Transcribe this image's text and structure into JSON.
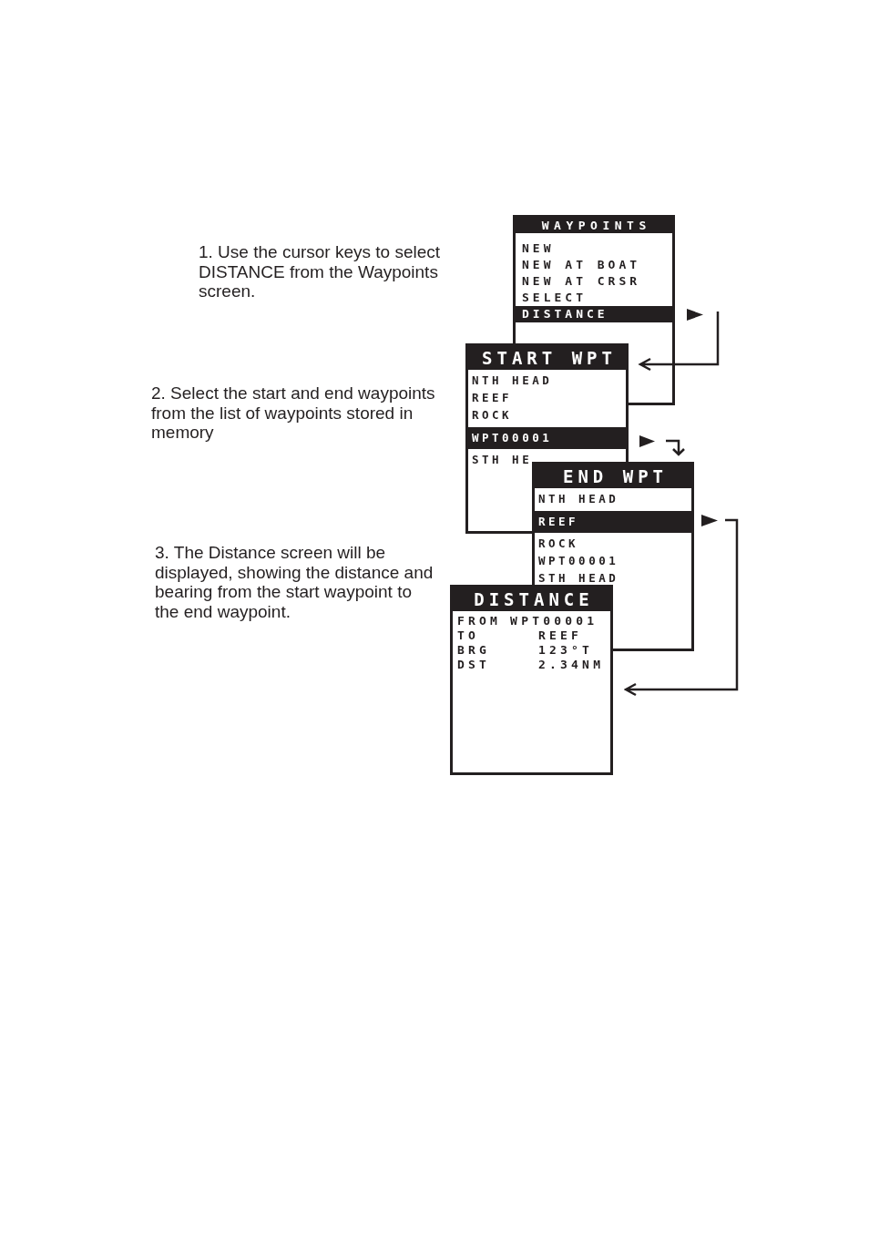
{
  "steps": [
    "1. Use the cursor keys to select DISTANCE from the Waypoints screen.",
    "2. Select the start and end waypoints from the list of waypoints stored in memory",
    "3. The Distance screen will be displayed, showing the distance and bearing from the start waypoint to the end waypoint."
  ],
  "screens": [
    {
      "kind": "menu",
      "title": "WAYPOINTS",
      "items": [
        {
          "label": "NEW",
          "selected": false
        },
        {
          "label": "NEW AT BOAT",
          "selected": false
        },
        {
          "label": "NEW AT CRSR",
          "selected": false
        },
        {
          "label": "SELECT",
          "selected": false
        },
        {
          "label": "DISTANCE",
          "selected": true
        }
      ]
    },
    {
      "kind": "list",
      "title": "START WPT",
      "items": [
        {
          "label": "NTH HEAD",
          "selected": false
        },
        {
          "label": "REEF",
          "selected": false
        },
        {
          "label": "ROCK",
          "selected": false
        },
        {
          "label": "WPT00001",
          "selected": true
        },
        {
          "label": "STH HE",
          "selected": false
        }
      ]
    },
    {
      "kind": "list",
      "title": "END WPT",
      "items": [
        {
          "label": "NTH HEAD",
          "selected": false
        },
        {
          "label": "REEF",
          "selected": true
        },
        {
          "label": "ROCK",
          "selected": false
        },
        {
          "label": "WPT00001",
          "selected": false
        },
        {
          "label": "STH HEAD",
          "selected": false
        }
      ]
    },
    {
      "kind": "readout",
      "title": "DISTANCE",
      "rows": [
        {
          "kind": "inline",
          "label": "FROM",
          "value": "WPT00001"
        },
        {
          "kind": "tabbed",
          "label": "TO",
          "value": "REEF"
        },
        {
          "kind": "tabbed",
          "label": "BRG",
          "value": "123°T"
        },
        {
          "kind": "tabbed",
          "label": "DST",
          "value": "2.34NM"
        }
      ]
    }
  ]
}
